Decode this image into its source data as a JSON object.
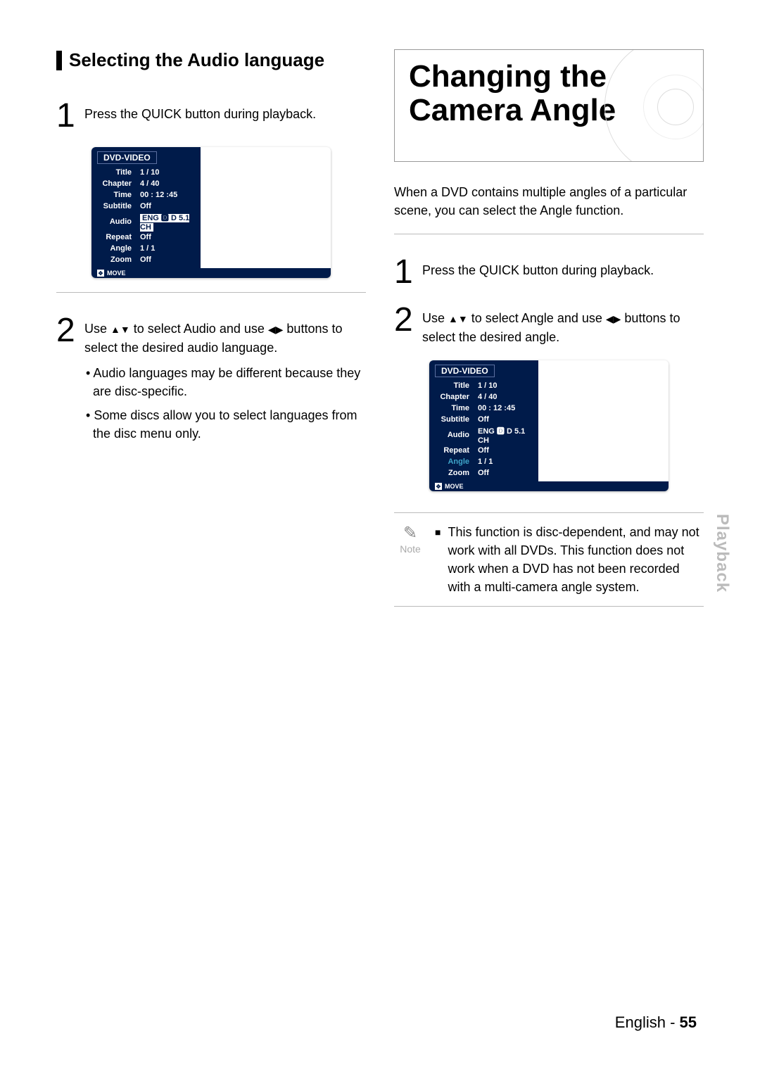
{
  "sideTab": "Playback",
  "footer": {
    "lang": "English",
    "sep": " - ",
    "page": "55"
  },
  "left": {
    "subhead": "Selecting the Audio language",
    "step1": {
      "num": "1",
      "text": "Press the QUICK button during playback."
    },
    "step2": {
      "num": "2",
      "text_pre": "Use ",
      "text_mid": " to select Audio and use ",
      "text_post": " buttons to select the desired audio language.",
      "arrows_ud": "▲▼",
      "arrows_lr": "◀▶",
      "bullets": [
        "Audio languages may be different because they are disc-specific.",
        "Some discs allow you to select languages from the disc menu only."
      ]
    },
    "osd": {
      "header": "DVD-VIDEO",
      "move": "MOVE",
      "rows": [
        {
          "k": "Title",
          "v": "1 / 10"
        },
        {
          "k": "Chapter",
          "v": "4 / 40"
        },
        {
          "k": "Time",
          "v": "00 : 12 :45"
        },
        {
          "k": "Subtitle",
          "v": "Off"
        },
        {
          "k": "Audio",
          "v": "ENG 🅳 D 5.1 CH",
          "selected": true
        },
        {
          "k": "Repeat",
          "v": "Off"
        },
        {
          "k": "Angle",
          "v": "1 / 1"
        },
        {
          "k": "Zoom",
          "v": "Off"
        }
      ]
    }
  },
  "right": {
    "title": "Changing the Camera Angle",
    "intro": "When a DVD contains multiple angles of a particular scene, you can select the Angle function.",
    "step1": {
      "num": "1",
      "text": "Press the QUICK button during playback."
    },
    "step2": {
      "num": "2",
      "text_pre": "Use ",
      "text_mid": " to select Angle and use ",
      "text_post": " buttons to select the desired angle.",
      "arrows_ud": "▲▼",
      "arrows_lr": "◀▶"
    },
    "osd": {
      "header": "DVD-VIDEO",
      "move": "MOVE",
      "rows": [
        {
          "k": "Title",
          "v": "1 / 10"
        },
        {
          "k": "Chapter",
          "v": "4 / 40"
        },
        {
          "k": "Time",
          "v": "00 : 12 :45"
        },
        {
          "k": "Subtitle",
          "v": "Off"
        },
        {
          "k": "Audio",
          "v": "ENG 🅳 D 5.1 CH"
        },
        {
          "k": "Repeat",
          "v": "Off"
        },
        {
          "k": "Angle",
          "v": "1 / 1",
          "highlight": true
        },
        {
          "k": "Zoom",
          "v": "Off"
        }
      ]
    },
    "note": {
      "label": "Note",
      "bullet": "■",
      "text": "This function is disc-dependent, and may not work with all DVDs. This function does not work when a DVD has not been recorded with a multi-camera angle system."
    }
  }
}
